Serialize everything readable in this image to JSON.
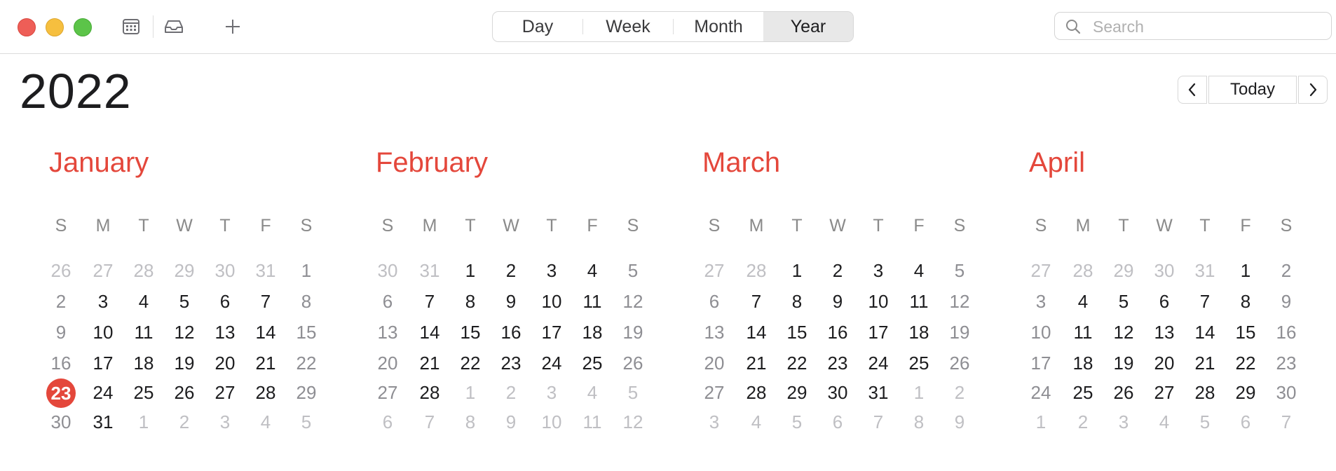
{
  "toolbar": {
    "views": [
      "Day",
      "Week",
      "Month",
      "Year"
    ],
    "selected_view": "Year",
    "search_placeholder": "Search"
  },
  "year": "2022",
  "nav": {
    "today_label": "Today"
  },
  "weekday_labels": [
    "S",
    "M",
    "T",
    "W",
    "T",
    "F",
    "S"
  ],
  "today": "23",
  "colors": {
    "accent": "#e4473b",
    "weekday": "#1d1d1f",
    "weekend": "#8e8e93",
    "other_month": "#bfbfc3"
  },
  "months": [
    {
      "name": "January",
      "weeks": [
        [
          "26",
          "27",
          "28",
          "29",
          "30",
          "31",
          "1"
        ],
        [
          "2",
          "3",
          "4",
          "5",
          "6",
          "7",
          "8"
        ],
        [
          "9",
          "10",
          "11",
          "12",
          "13",
          "14",
          "15"
        ],
        [
          "16",
          "17",
          "18",
          "19",
          "20",
          "21",
          "22"
        ],
        [
          "23",
          "24",
          "25",
          "26",
          "27",
          "28",
          "29"
        ],
        [
          "30",
          "31",
          "1",
          "2",
          "3",
          "4",
          "5"
        ]
      ],
      "today_cell": [
        4,
        0
      ]
    },
    {
      "name": "February",
      "weeks": [
        [
          "30",
          "31",
          "1",
          "2",
          "3",
          "4",
          "5"
        ],
        [
          "6",
          "7",
          "8",
          "9",
          "10",
          "11",
          "12"
        ],
        [
          "13",
          "14",
          "15",
          "16",
          "17",
          "18",
          "19"
        ],
        [
          "20",
          "21",
          "22",
          "23",
          "24",
          "25",
          "26"
        ],
        [
          "27",
          "28",
          "1",
          "2",
          "3",
          "4",
          "5"
        ],
        [
          "6",
          "7",
          "8",
          "9",
          "10",
          "11",
          "12"
        ]
      ]
    },
    {
      "name": "March",
      "weeks": [
        [
          "27",
          "28",
          "1",
          "2",
          "3",
          "4",
          "5"
        ],
        [
          "6",
          "7",
          "8",
          "9",
          "10",
          "11",
          "12"
        ],
        [
          "13",
          "14",
          "15",
          "16",
          "17",
          "18",
          "19"
        ],
        [
          "20",
          "21",
          "22",
          "23",
          "24",
          "25",
          "26"
        ],
        [
          "27",
          "28",
          "29",
          "30",
          "31",
          "1",
          "2"
        ],
        [
          "3",
          "4",
          "5",
          "6",
          "7",
          "8",
          "9"
        ]
      ]
    },
    {
      "name": "April",
      "weeks": [
        [
          "27",
          "28",
          "29",
          "30",
          "31",
          "1",
          "2"
        ],
        [
          "3",
          "4",
          "5",
          "6",
          "7",
          "8",
          "9"
        ],
        [
          "10",
          "11",
          "12",
          "13",
          "14",
          "15",
          "16"
        ],
        [
          "17",
          "18",
          "19",
          "20",
          "21",
          "22",
          "23"
        ],
        [
          "24",
          "25",
          "26",
          "27",
          "28",
          "29",
          "30"
        ],
        [
          "1",
          "2",
          "3",
          "4",
          "5",
          "6",
          "7"
        ]
      ]
    }
  ]
}
